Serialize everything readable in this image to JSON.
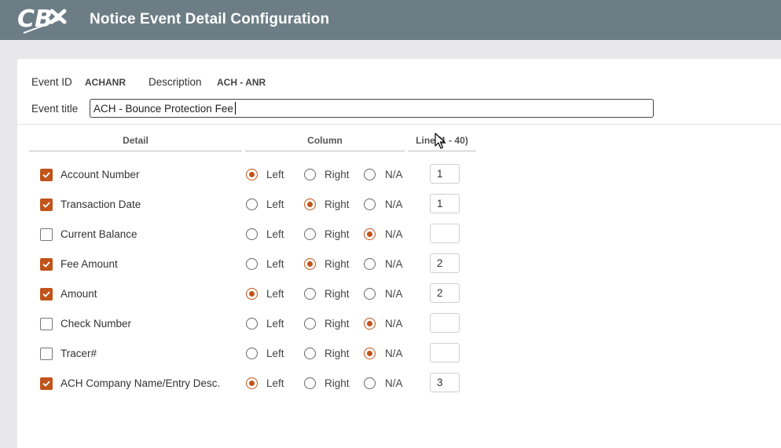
{
  "header": {
    "logo_text": "CB",
    "title": "Notice Event Detail Configuration"
  },
  "event": {
    "id_label": "Event ID",
    "id_value": "ACHANR",
    "description_label": "Description",
    "description_value": "ACH - ANR",
    "title_label": "Event title",
    "title_value": "ACH - Bounce Protection Fee"
  },
  "columns": {
    "detail": "Detail",
    "column": "Column",
    "line": "Line (1 - 40)"
  },
  "radio_labels": {
    "left": "Left",
    "right": "Right",
    "na": "N/A"
  },
  "rows": [
    {
      "label": "Account Number",
      "checked": true,
      "column": "left",
      "line": "1"
    },
    {
      "label": "Transaction Date",
      "checked": true,
      "column": "right",
      "line": "1"
    },
    {
      "label": "Current Balance",
      "checked": false,
      "column": "na",
      "line": ""
    },
    {
      "label": "Fee Amount",
      "checked": true,
      "column": "right",
      "line": "2"
    },
    {
      "label": "Amount",
      "checked": true,
      "column": "left",
      "line": "2"
    },
    {
      "label": "Check Number",
      "checked": false,
      "column": "na",
      "line": ""
    },
    {
      "label": "Tracer#",
      "checked": false,
      "column": "na",
      "line": ""
    },
    {
      "label": "ACH Company Name/Entry Desc.",
      "checked": true,
      "column": "left",
      "line": "3"
    }
  ],
  "colors": {
    "header_bg": "#6c7d86",
    "accent": "#c0541b",
    "page_bg": "#e8e8ec"
  }
}
